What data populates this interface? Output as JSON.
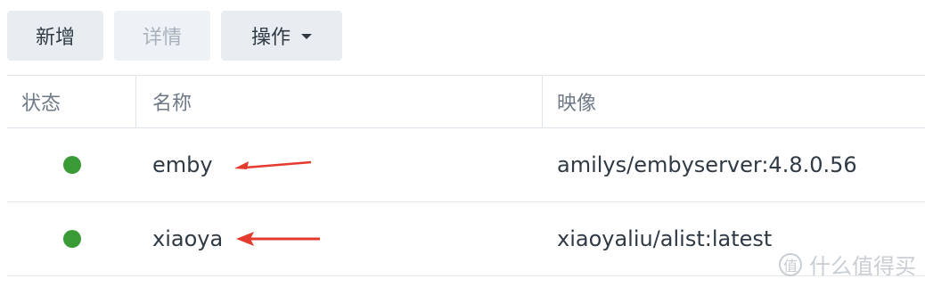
{
  "toolbar": {
    "add_label": "新增",
    "detail_label": "详情",
    "ops_label": "操作"
  },
  "table": {
    "headers": {
      "status": "状态",
      "name": "名称",
      "image": "映像"
    },
    "rows": [
      {
        "status": "running",
        "name": "emby",
        "image": "amilys/embyserver:4.8.0.56"
      },
      {
        "status": "running",
        "name": "xiaoya",
        "image": "xiaoyaliu/alist:latest"
      }
    ]
  },
  "colors": {
    "status_running": "#3a9a35",
    "arrow": "#e53b2f"
  },
  "watermark": {
    "icon": "值",
    "text": "什么值得买"
  }
}
